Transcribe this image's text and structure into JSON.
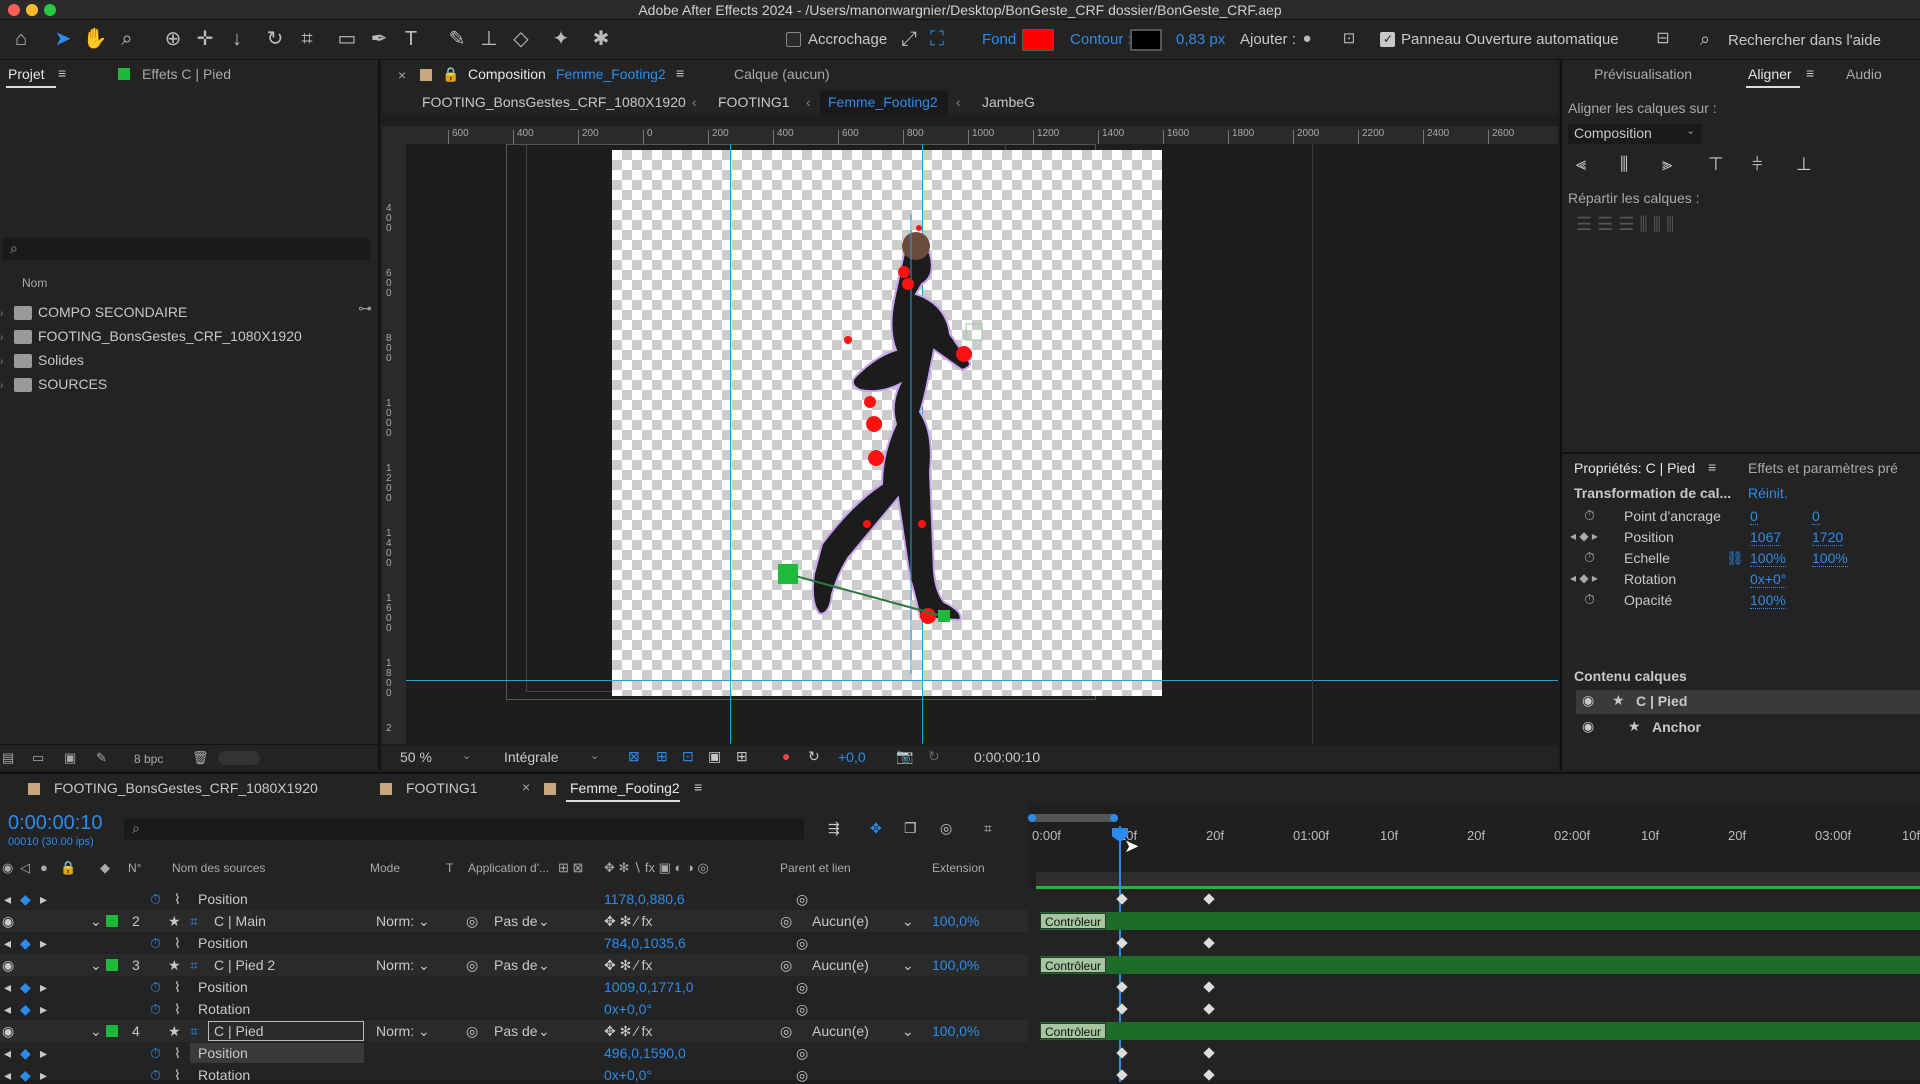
{
  "app_title": "Adobe After Effects 2024 - /Users/manonwargnier/Desktop/BonGeste_CRF dossier/BonGeste_CRF.aep",
  "toolbar": {
    "snap_label": "Accrochage",
    "fill_label": "Fond :",
    "stroke_label": "Contour :",
    "stroke_width": "0,83 px",
    "add_label": "Ajouter :",
    "auto_open_label": "Panneau Ouverture automatique",
    "help_search": "Rechercher dans l'aide",
    "fill_color": "#ff0000",
    "stroke_color": "#000000"
  },
  "project_panel": {
    "tab_project": "Projet",
    "tab_effects": "Effets C | Pied",
    "col_name": "Nom",
    "items": [
      "COMPO SECONDAIRE",
      "FOOTING_BonsGestes_CRF_1080X1920",
      "Solides",
      "SOURCES"
    ],
    "bpc": "8 bpc"
  },
  "comp_panel": {
    "tab_prefix": "Composition",
    "tab_name": "Femme_Footing2",
    "layer_tab": "Calque (aucun)",
    "breadcrumbs": [
      "FOOTING_BonsGestes_CRF_1080X1920",
      "FOOTING1",
      "Femme_Footing2",
      "JambeG"
    ],
    "ruler_marks": [
      "600",
      "400",
      "200",
      "0",
      "200",
      "400",
      "600",
      "800",
      "1000",
      "1200",
      "1400",
      "1600",
      "1800",
      "2000",
      "2200",
      "2400",
      "2600"
    ],
    "vruler_marks": [
      "4 0 0",
      "6 0 0",
      "8 0 0",
      "1 0 0 0",
      "1 2 0 0",
      "1 4 0 0",
      "1 6 0 0",
      "1 8 0 0",
      "2"
    ],
    "zoom": "50 %",
    "resolution": "Intégrale",
    "exposure": "+0,0",
    "timecode": "0:00:00:10"
  },
  "right_panel": {
    "tab_preview": "Prévisualisation",
    "tab_align": "Aligner",
    "tab_audio": "Audio",
    "align_label": "Aligner les calques sur :",
    "align_target": "Composition",
    "distribute_label": "Répartir les calques :",
    "props_tab": "Propriétés: C | Pied",
    "effects_tab": "Effets et paramètres pré",
    "transform_label": "Transformation de cal...",
    "reset": "Réinit.",
    "props": [
      {
        "name": "Point d'ancrage",
        "v1": "0",
        "v2": "0"
      },
      {
        "name": "Position",
        "v1": "1067",
        "v2": "1720"
      },
      {
        "name": "Echelle",
        "v1": "100%",
        "v2": "100%"
      },
      {
        "name": "Rotation",
        "v1": "0x+0°",
        "v2": ""
      },
      {
        "name": "Opacité",
        "v1": "100%",
        "v2": ""
      }
    ],
    "content_label": "Contenu calques",
    "content_items": [
      "C | Pied",
      "Anchor"
    ]
  },
  "timeline": {
    "tabs": [
      "FOOTING_BonsGestes_CRF_1080X1920",
      "FOOTING1",
      "Femme_Footing2"
    ],
    "current_time": "0:00:00:10",
    "fps": "00010 (30.00 ips)",
    "col_num": "N°",
    "col_source": "Nom des sources",
    "col_mode": "Mode",
    "col_t": "T",
    "col_app": "Application d'...",
    "col_parent": "Parent et lien",
    "col_ext": "Extension",
    "time_marks": [
      "0:00f",
      "10f",
      "20f",
      "01:00f",
      "10f",
      "20f",
      "02:00f",
      "10f",
      "20f",
      "03:00f",
      "10f"
    ],
    "rows": [
      {
        "type": "prop",
        "name": "Position",
        "value": "1178,0,880,6"
      },
      {
        "type": "layer",
        "num": "2",
        "name": "C | Main",
        "mode": "Norm:",
        "app": "Pas de",
        "parent": "Aucun(e)",
        "ext": "100,0%"
      },
      {
        "type": "prop",
        "name": "Position",
        "value": "784,0,1035,6"
      },
      {
        "type": "layer",
        "num": "3",
        "name": "C | Pied 2",
        "mode": "Norm:",
        "app": "Pas de",
        "parent": "Aucun(e)",
        "ext": "100,0%"
      },
      {
        "type": "prop",
        "name": "Position",
        "value": "1009,0,1771,0"
      },
      {
        "type": "prop",
        "name": "Rotation",
        "value": "0x+0,0°"
      },
      {
        "type": "layer",
        "num": "4",
        "name": "C | Pied",
        "mode": "Norm:",
        "app": "Pas de",
        "parent": "Aucun(e)",
        "ext": "100,0%"
      },
      {
        "type": "prop",
        "name": "Position",
        "value": "496,0,1590,0"
      },
      {
        "type": "prop",
        "name": "Rotation",
        "value": "0x+0,0°"
      }
    ],
    "controller_label": "Contrôleur"
  }
}
